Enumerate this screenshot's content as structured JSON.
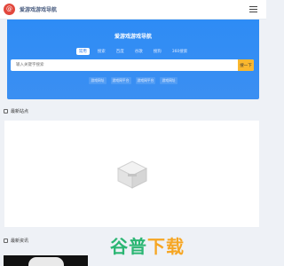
{
  "topnav": {
    "logo_text": "@",
    "site_title": "爱游戏游戏导航",
    "menu_icon": "menu-icon"
  },
  "hero": {
    "title": "爱游戏游戏导航",
    "tabs": [
      {
        "label": "常用",
        "active": true
      },
      {
        "label": "搜索"
      },
      {
        "label": "百度"
      },
      {
        "label": "谷歌"
      },
      {
        "label": "搜狗"
      },
      {
        "label": "360搜索"
      }
    ],
    "search": {
      "placeholder": "输入关键字搜索",
      "button_label": "搜一下"
    },
    "links": [
      "游戏网址",
      "游戏网平台",
      "游戏网平台",
      "游戏网址"
    ]
  },
  "sections": {
    "latest_sites": "最新站点",
    "latest_news": "最新资讯"
  },
  "empty_state": {
    "icon": "empty-box-icon"
  },
  "watermark": {
    "text_part1": "谷普",
    "text_part2": "下载"
  },
  "colors": {
    "hero_bg": "#2e8cf5",
    "search_button": "#fab72e",
    "logo": "#e2483d",
    "watermark_green": "#2bb673",
    "watermark_orange": "#f6a623"
  }
}
